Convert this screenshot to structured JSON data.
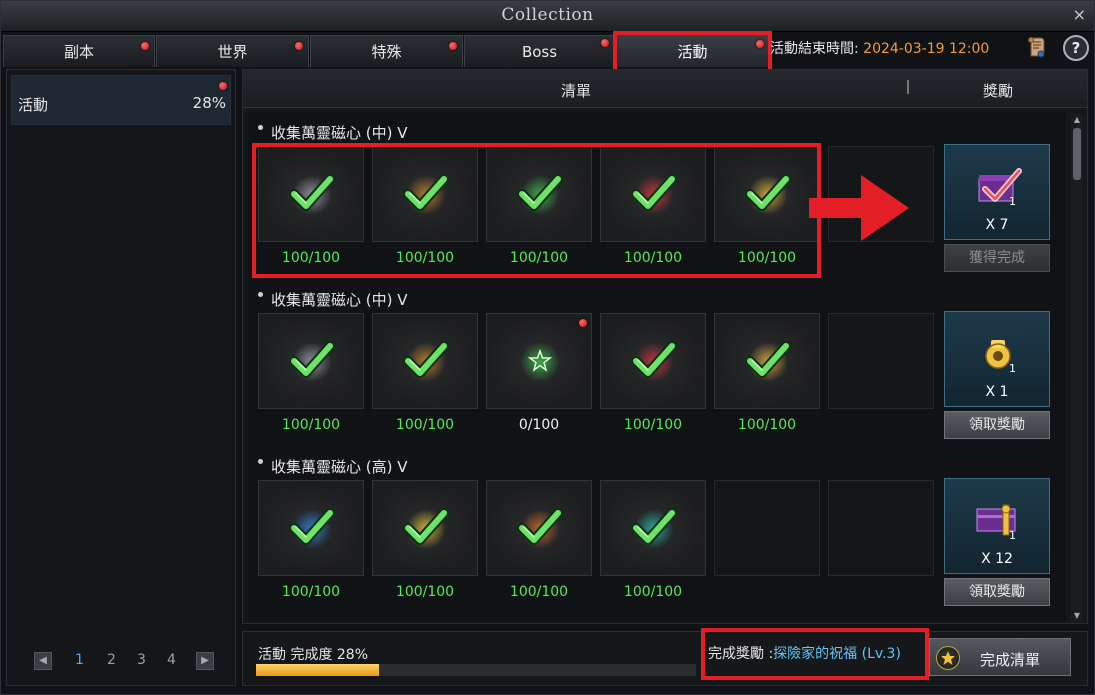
{
  "window": {
    "title": "Collection",
    "close_glyph": "×"
  },
  "tabs": [
    {
      "label": "副本",
      "active": false,
      "has_notification": true
    },
    {
      "label": "世界",
      "active": false,
      "has_notification": true
    },
    {
      "label": "特殊",
      "active": false,
      "has_notification": true
    },
    {
      "label": "Boss",
      "active": false,
      "has_notification": true
    },
    {
      "label": "活動",
      "active": true,
      "has_notification": true
    }
  ],
  "event_end": {
    "label": "活動結束時間:",
    "datetime": "2024-03-19 12:00"
  },
  "help_label": "?",
  "sidebar": {
    "items": [
      {
        "label": "活動",
        "percent": "28%",
        "has_notification": true
      }
    ],
    "pagination": {
      "pages": [
        "1",
        "2",
        "3",
        "4"
      ],
      "current": "1",
      "prev_glyph": "◀",
      "next_glyph": "▶"
    }
  },
  "main": {
    "header": {
      "list_label": "清單",
      "reward_label": "獎勵"
    },
    "rows": [
      {
        "title": "收集萬靈磁心 (中) V",
        "items": [
          {
            "icon": "silver-core-icon",
            "progress": "100/100",
            "complete": true,
            "glow": "#8a8f99"
          },
          {
            "icon": "bronze-core-icon",
            "progress": "100/100",
            "complete": true,
            "glow": "#b07a2e"
          },
          {
            "icon": "green-core-icon",
            "progress": "100/100",
            "complete": true,
            "glow": "#3fa54a"
          },
          {
            "icon": "red-core-icon",
            "progress": "100/100",
            "complete": true,
            "glow": "#c0343a"
          },
          {
            "icon": "gold-core-icon",
            "progress": "100/100",
            "complete": true,
            "glow": "#c9a13a"
          }
        ],
        "reward": {
          "icon": "purple-box-icon",
          "quantity": "X 7",
          "stack": "1",
          "button": "獲得完成",
          "button_enabled": false,
          "claimed": true
        }
      },
      {
        "title": "收集萬靈磁心 (中) V",
        "items": [
          {
            "icon": "silver-core-icon",
            "progress": "100/100",
            "complete": true,
            "glow": "#8a8f99"
          },
          {
            "icon": "bronze-core-icon",
            "progress": "100/100",
            "complete": true,
            "glow": "#b07a2e"
          },
          {
            "icon": "green-core-icon",
            "progress": "0/100",
            "complete": false,
            "glow": "#3fa54a",
            "has_notification": true
          },
          {
            "icon": "red-core-icon",
            "progress": "100/100",
            "complete": true,
            "glow": "#c0343a"
          },
          {
            "icon": "gold-core-icon",
            "progress": "100/100",
            "complete": true,
            "glow": "#c9a13a"
          }
        ],
        "reward": {
          "icon": "gold-pouch-icon",
          "quantity": "X 1",
          "stack": "1",
          "button": "領取獎勵",
          "button_enabled": true,
          "claimed": false
        }
      },
      {
        "title": "收集萬靈磁心 (高) V",
        "items": [
          {
            "icon": "blue-core-icon",
            "progress": "100/100",
            "complete": true,
            "glow": "#2f78c4"
          },
          {
            "icon": "yellow-core-icon",
            "progress": "100/100",
            "complete": true,
            "glow": "#c9b33a"
          },
          {
            "icon": "orange-core-icon",
            "progress": "100/100",
            "complete": true,
            "glow": "#b5652a"
          },
          {
            "icon": "teal-core-icon",
            "progress": "100/100",
            "complete": true,
            "glow": "#2aa59a"
          }
        ],
        "reward": {
          "icon": "purple-key-box-icon",
          "quantity": "X 12",
          "stack": "1",
          "button": "領取獎勵",
          "button_enabled": true,
          "claimed": false
        }
      }
    ]
  },
  "footer": {
    "completion_label": "活動 完成度 28%",
    "completion_value": 0.28,
    "completion_reward_label": "完成獎勵 :",
    "completion_reward_name": "探險家的祝福 (Lv.3)",
    "finish_button": "完成清單"
  },
  "colors": {
    "highlight": "#e41e26",
    "progress_done": "#55e85a",
    "date": "#f29a3a",
    "reward_name": "#5ec6f2",
    "progress_fill": "#e69a14"
  }
}
